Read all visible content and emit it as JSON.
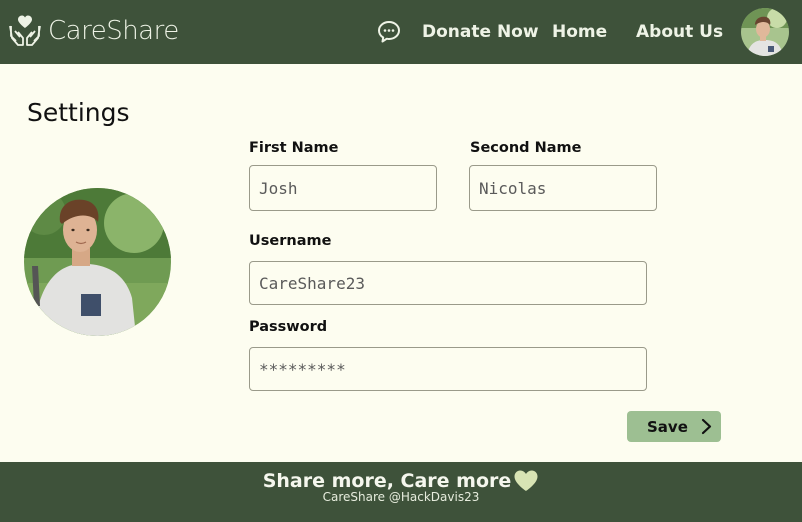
{
  "header": {
    "brand": "CareShare",
    "nav": {
      "donate": "Donate Now",
      "home": "Home",
      "about": "About Us"
    }
  },
  "main": {
    "title": "Settings",
    "form": {
      "first_name_label": "First Name",
      "first_name_value": "Josh",
      "second_name_label": "Second Name",
      "second_name_value": "Nicolas",
      "username_label": "Username",
      "username_value": "CareShare23",
      "password_label": "Password",
      "password_value": "*********"
    },
    "save_label": "Save"
  },
  "footer": {
    "tagline": "Share more, Care more",
    "credit": "CareShare @HackDavis23"
  },
  "colors": {
    "header_bg": "#3e523a",
    "page_bg": "#fdfdf0",
    "save_button": "#9dbf92",
    "heart": "#d8e4b4"
  },
  "icons": {
    "logo": "hands-heart-icon",
    "chat": "chat-bubble-icon",
    "save": "chevron-right-icon",
    "footer": "heart-icon"
  }
}
